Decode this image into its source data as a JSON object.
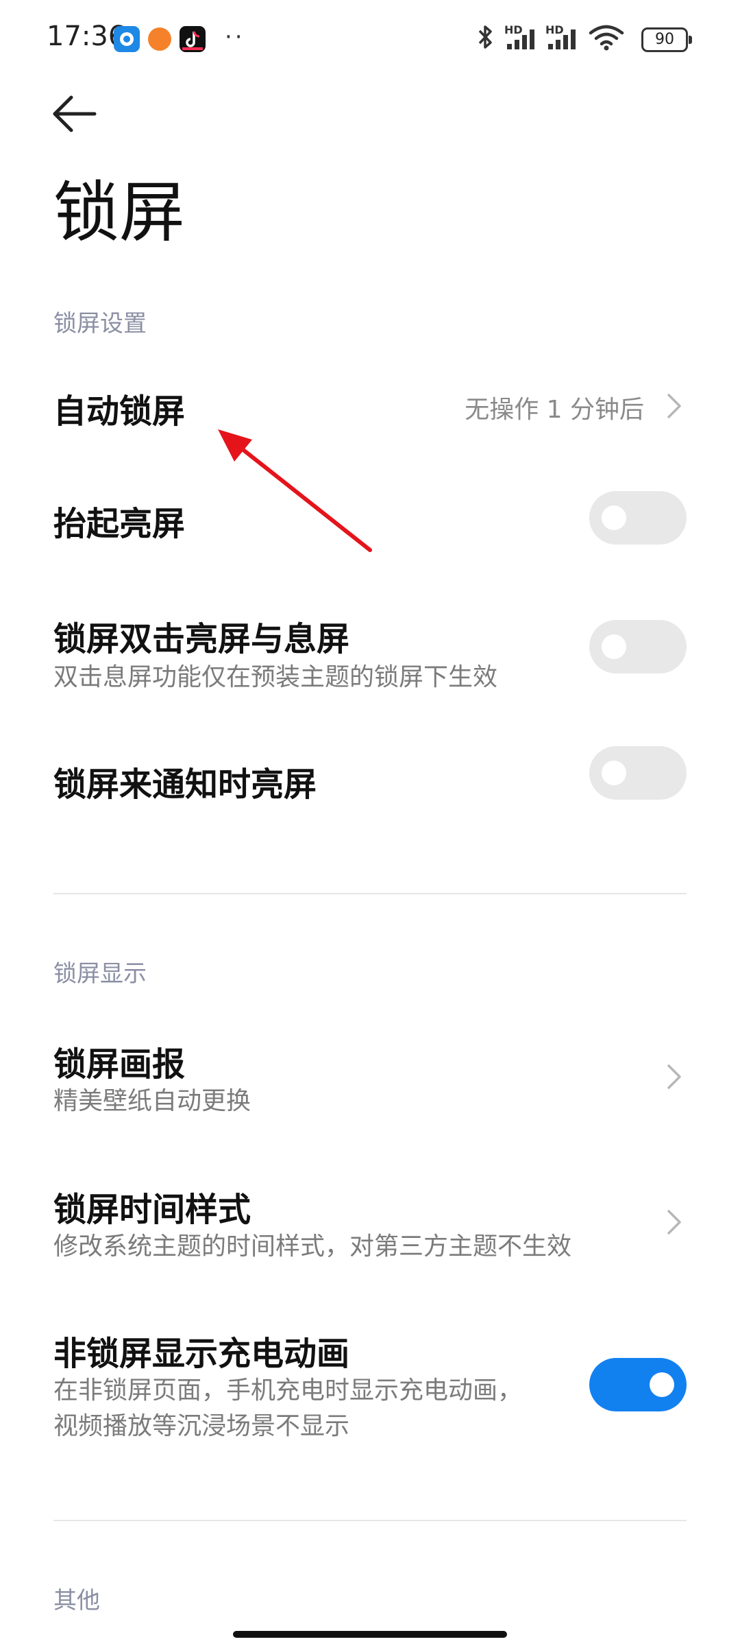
{
  "status_bar": {
    "time": "17:36",
    "dots": "··",
    "battery": "90",
    "network_label_1": "HD",
    "network_label_2": "HD",
    "icons": [
      "blue-app-icon",
      "orange-app-icon",
      "tiktok-icon",
      "bluetooth-icon",
      "signal-icon",
      "signal-icon",
      "wifi-icon",
      "battery-icon"
    ]
  },
  "header": {
    "title": "锁屏",
    "back_icon": "back-arrow-icon"
  },
  "sections": [
    {
      "label": "锁屏设置",
      "rows": [
        {
          "title": "自动锁屏",
          "value": "无操作 1 分钟后",
          "control": "chevron"
        },
        {
          "title": "抬起亮屏",
          "control": "toggle",
          "on": false
        },
        {
          "title": "锁屏双击亮屏与息屏",
          "subtitle": "双击息屏功能仅在预装主题的锁屏下生效",
          "control": "toggle",
          "on": false
        },
        {
          "title": "锁屏来通知时亮屏",
          "control": "toggle",
          "on": false
        }
      ]
    },
    {
      "label": "锁屏显示",
      "rows": [
        {
          "title": "锁屏画报",
          "subtitle": "精美壁纸自动更换",
          "control": "chevron"
        },
        {
          "title": "锁屏时间样式",
          "subtitle": "修改系统主题的时间样式，对第三方主题不生效",
          "control": "chevron"
        },
        {
          "title": "非锁屏显示充电动画",
          "subtitle_lines": [
            "在非锁屏页面，手机充电时显示充电动画，",
            "视频播放等沉浸场景不显示"
          ],
          "control": "toggle",
          "on": true
        }
      ]
    },
    {
      "label": "其他",
      "rows": []
    }
  ],
  "colors": {
    "accent": "#1281f0",
    "section_label": "#8a8fa3",
    "annotation": "#e5141b"
  }
}
